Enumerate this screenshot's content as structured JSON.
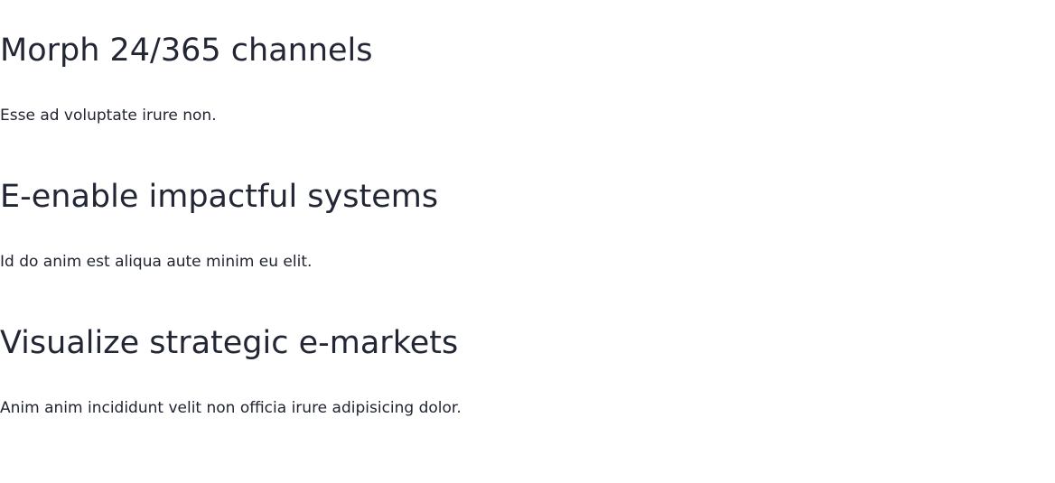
{
  "features": [
    {
      "title": "Morph 24/365 channels",
      "description": "Esse ad voluptate irure non."
    },
    {
      "title": "E-enable impactful systems",
      "description": "Id do anim est aliqua aute minim eu elit."
    },
    {
      "title": "Visualize strategic e-markets",
      "description": "Anim anim incididunt velit non officia irure adipisicing dolor."
    }
  ]
}
